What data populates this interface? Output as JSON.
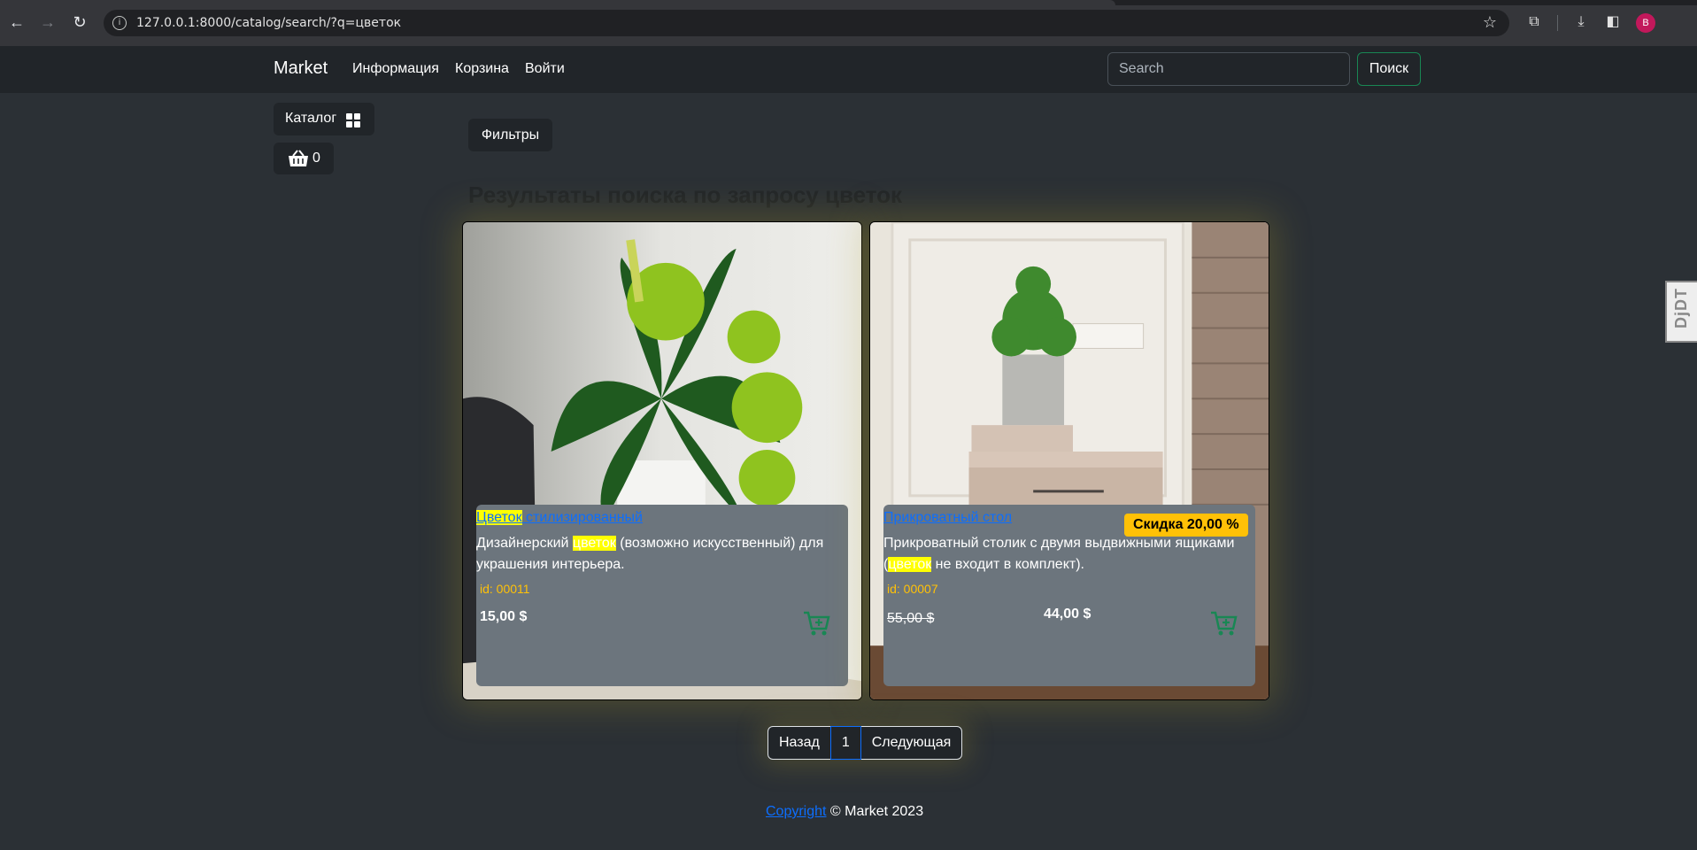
{
  "browser": {
    "url": "127.0.0.1:8000/catalog/search/?q=цветок",
    "profile_initial": "B"
  },
  "navbar": {
    "brand": "Market",
    "links": [
      "Информация",
      "Корзина",
      "Войти"
    ],
    "search_placeholder": "Search",
    "search_button": "Поиск"
  },
  "sidebar": {
    "catalog_label": "Каталог",
    "cart_count": "0"
  },
  "filters_label": "Фильтры",
  "results_title": "Результаты поиска по запросу цветок",
  "products": [
    {
      "title_highlight": "Цветок",
      "title_rest": " стилизированный",
      "desc_before": "Дизайнерский ",
      "desc_highlight": "цветок",
      "desc_after": " (возможно искусственный) для украшения интерьера.",
      "id": "id: 00011",
      "price": "15,00 $"
    },
    {
      "title": "Прикроватный стол",
      "desc_before": "Прикроватный столик с двумя выдвижными ящиками (",
      "desc_highlight": "цветок",
      "desc_after": " не входит в комплект).",
      "id": "id: 00007",
      "old_price": "55,00 $",
      "new_price": "44,00 $",
      "discount": "Скидка 20,00 %"
    }
  ],
  "pagination": {
    "prev": "Назад",
    "current": "1",
    "next": "Следующая"
  },
  "footer": {
    "link": "Copyright",
    "text": " © Market 2023"
  },
  "debug_toolbar": "DjDT",
  "colors": {
    "page_bg": "#2b3035",
    "navbar_bg": "#212529",
    "link": "#0d6efd",
    "highlight": "#ffff00",
    "badge": "#ffc107",
    "success": "#198754",
    "card_panel": "#6c757d"
  }
}
